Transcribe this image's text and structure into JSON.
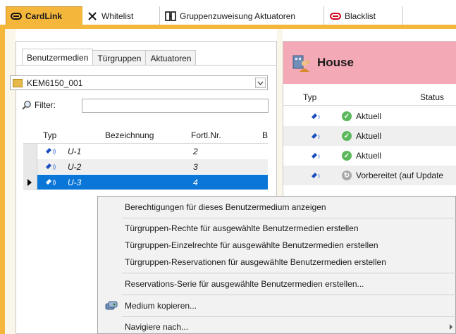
{
  "tabs": [
    {
      "label": "CardLink",
      "icon": "cardlink-icon"
    },
    {
      "label": "Whitelist",
      "icon": "x-icon"
    },
    {
      "label": "Gruppenzuweisung Aktuatoren",
      "icon": "group-actuator-icon"
    },
    {
      "label": "Blacklist",
      "icon": "blacklist-icon"
    }
  ],
  "left": {
    "subtabs": [
      "Benutzermedien",
      "Türgruppen",
      "Aktuatoren"
    ],
    "combo_value": "KEM6150_001",
    "filter_label": "Filter:",
    "filter_value": "",
    "columns": [
      "Typ",
      "Bezeichnung",
      "Fortl.Nr.",
      "B"
    ],
    "rows": [
      {
        "name": "U-1",
        "num": "2"
      },
      {
        "name": "U-2",
        "num": "3"
      },
      {
        "name": "U-3",
        "num": "4"
      }
    ]
  },
  "right": {
    "title": "House",
    "columns": [
      "Typ",
      "Status"
    ],
    "rows": [
      {
        "status": "Aktuell"
      },
      {
        "status": "Aktuell"
      },
      {
        "status": "Aktuell"
      },
      {
        "status": "Vorbereitet (auf Update"
      }
    ]
  },
  "context_menu": {
    "items": [
      "Berechtigungen für dieses Benutzermedium anzeigen",
      "Türgruppen-Rechte für ausgewählte Benutzermedien erstellen",
      "Türgruppen-Einzelrechte für ausgewählte Benutzermedien erstellen",
      "Türgruppen-Reservationen für ausgewählte Benutzermedien erstellen",
      "Reservations-Serie für ausgewählte Benutzermedien erstellen...",
      "Medium kopieren...",
      "Navigiere nach..."
    ]
  },
  "colors": {
    "accent": "#f5b63c",
    "selection": "#0a77d8",
    "house_header": "#f4a9b6",
    "status_ok": "#5cb85c"
  }
}
